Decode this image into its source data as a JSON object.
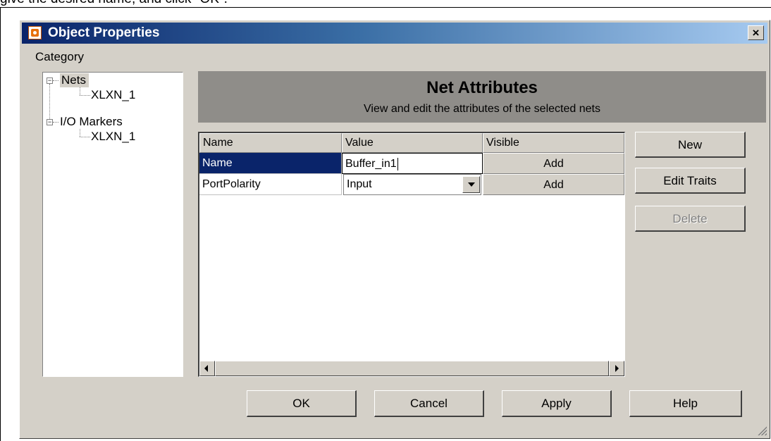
{
  "document": {
    "caption": "give the desired name, and click \"OK\"."
  },
  "window": {
    "title": "Object Properties",
    "close_glyph": "×"
  },
  "category": {
    "label": "Category",
    "tree": [
      {
        "label": "Nets",
        "selected": true,
        "children": [
          {
            "label": "XLXN_1"
          }
        ]
      },
      {
        "label": "I/O Markers",
        "selected": false,
        "children": [
          {
            "label": "XLXN_1"
          }
        ]
      }
    ]
  },
  "panel": {
    "title": "Net Attributes",
    "subtitle": "View and edit the attributes of the selected nets"
  },
  "grid": {
    "columns": [
      "Name",
      "Value",
      "Visible"
    ],
    "rows": [
      {
        "name": "Name",
        "value": "Buffer_in1",
        "visible": "Add",
        "editing": true
      },
      {
        "name": "PortPolarity",
        "value": "Input",
        "visible": "Add",
        "dropdown": true
      }
    ]
  },
  "side_buttons": {
    "new": "New",
    "edit_traits": "Edit Traits",
    "delete": "Delete"
  },
  "bottom_buttons": {
    "ok": "OK",
    "cancel": "Cancel",
    "apply": "Apply",
    "help": "Help"
  },
  "colors": {
    "title_gradient_start": "#0a246a",
    "title_gradient_end": "#a6caf0",
    "selection": "#0a246a",
    "dialog_bg": "#d4d0c8",
    "header_panel": "#8f8d89"
  }
}
